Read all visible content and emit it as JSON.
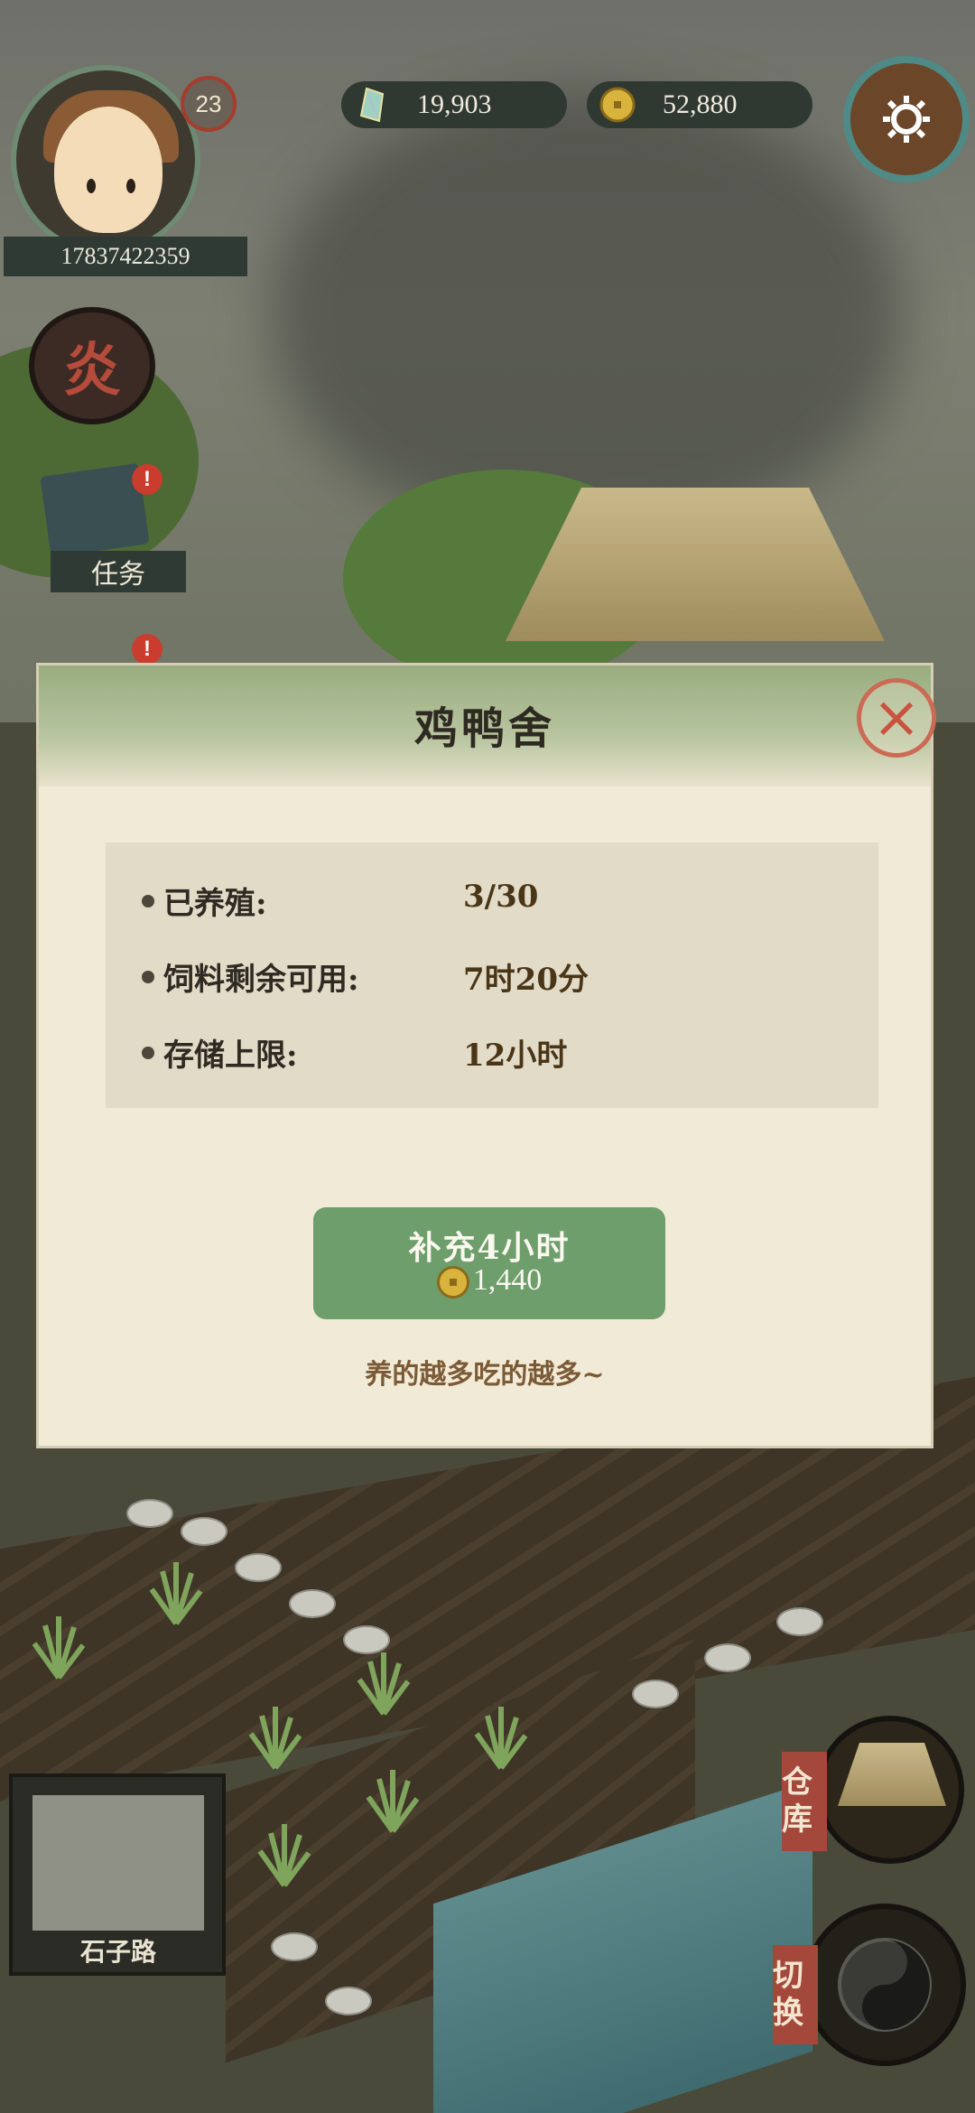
{
  "hud": {
    "player_id": "17837422359",
    "level": "23",
    "jade": "19,903",
    "coins": "52,880"
  },
  "side_menu": {
    "fire_glyph": "炎",
    "task_label": "任务",
    "alert_mark": "!"
  },
  "modal": {
    "title": "鸡鸭舍",
    "rows": [
      {
        "label": "已养殖:",
        "value": "3/30"
      },
      {
        "label": "饲料剩余可用:",
        "value": "7时20分"
      },
      {
        "label": "存储上限:",
        "value": "12小时"
      }
    ],
    "refill_label": "补充4小时",
    "refill_cost": "1,440",
    "hint": "养的越多吃的越多~"
  },
  "bottom": {
    "warehouse_tag": "仓库",
    "switch_tag": "切换",
    "map_label": "石子路"
  },
  "colors": {
    "button_green": "#6e9e6c",
    "close_red": "#c8533e",
    "modal_bg": "#f1ead6"
  }
}
